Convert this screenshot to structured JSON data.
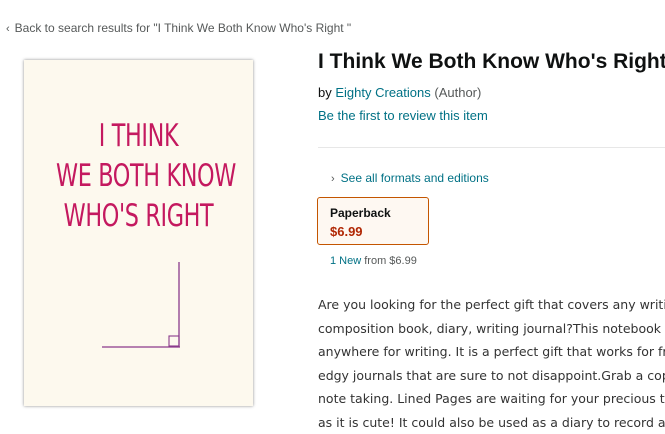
{
  "nav": {
    "back_chevron": "‹",
    "back_label": "Back to search results for \"I Think We Both Know Who's Right \""
  },
  "product": {
    "cover": {
      "lines": [
        "I THINK",
        "WE BOTH KNOW",
        "WHO'S RIGHT"
      ],
      "text_color": "#c4195f",
      "accent_color": "#8b3a8c",
      "background": "#fdf9ee"
    },
    "title": "I Think We Both Know Who's Right",
    "by_prefix": "by",
    "author": "Eighty Creations",
    "author_role": "(Author)",
    "review_link": "Be the first to review this item"
  },
  "formats": {
    "chevron": "›",
    "see_all": "See all formats and editions",
    "selected": {
      "name": "Paperback",
      "price": "$6.99"
    },
    "offers_link": "1 New",
    "offers_suffix": "from $6.99"
  },
  "description": {
    "lines": [
      "Are you looking for the perfect gift that covers any writing",
      "composition book, diary, writing journal?This notebook is",
      "anywhere for writing. It is a perfect gift that works for frie",
      "edgy journals that are sure to not disappoint.Grab a copy",
      "note taking. Lined Pages are waiting for your precious th",
      "as it is cute! It could also be used as a diary to record all"
    ]
  },
  "colors": {
    "link": "#007185",
    "price": "#b12704",
    "selected_border": "#c45500",
    "selected_bg": "#fef8f2"
  }
}
